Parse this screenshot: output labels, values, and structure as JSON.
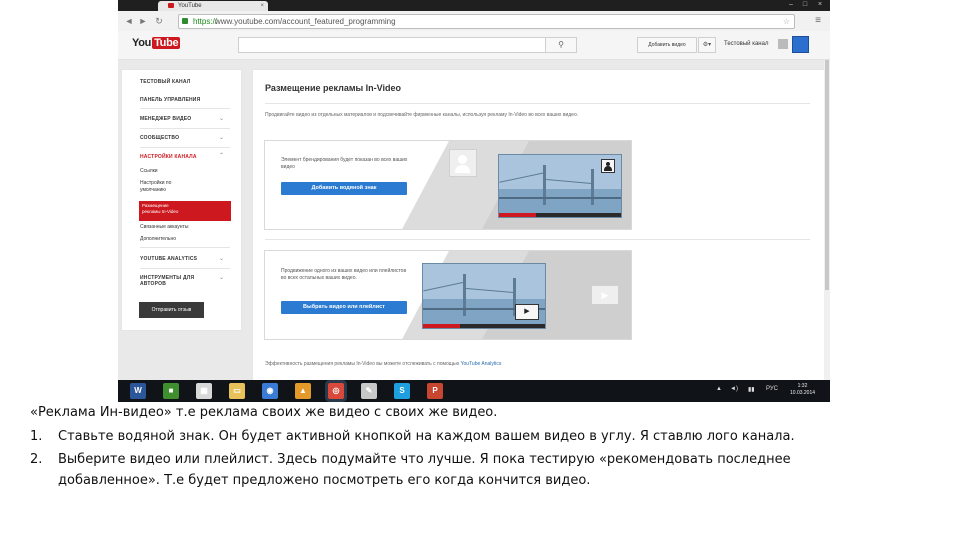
{
  "browser": {
    "tab_title": "YouTube",
    "tab_close": "×",
    "window_controls": [
      "–",
      "□",
      "×"
    ],
    "url_scheme": "https://",
    "url_rest": "www.youtube.com/account_featured_programming",
    "nav_icons": [
      "back-icon",
      "forward-icon",
      "reload-icon"
    ]
  },
  "youtube": {
    "logo_you": "You",
    "logo_tube": "Tube",
    "upload_label": "Добавить видео",
    "channel_name": "Тестовый канал"
  },
  "sidebar": {
    "channel": "ТЕСТОВЫЙ КАНАЛ",
    "dashboard": "ПАНЕЛЬ УПРАВЛЕНИЯ",
    "video_manager": "МЕНЕДЖЕР ВИДЕО",
    "community": "СООБЩЕСТВО",
    "channel_settings": "НАСТРОЙКИ КАНАЛА",
    "sub_items": [
      "Ссылки",
      "Настройки по",
      "умолчанию"
    ],
    "active_line1": "Размещение",
    "active_line2": "рекламы In-Video",
    "sub_items_2": [
      "Связанные аккаунты",
      "Дополнительно"
    ],
    "analytics": "YOUTUBE ANALYTICS",
    "tools_line1": "ИНСТРУМЕНТЫ ДЛЯ",
    "tools_line2": "АВТОРОВ",
    "feedback": "Отправить отзыв"
  },
  "main": {
    "title": "Размещение рекламы In-Video",
    "description": "Продвигайте видео из отдельных материалов и подсвечивайте фирменные каналы, используя рекламу In-Video во всех ваших видео.",
    "card1_text": "Элемент брендирования будет показан во всех ваших видео",
    "card1_button": "Добавить водяной знак",
    "card2_text": "Продвижение одного из ваших видео или плейлистов во всех остальных ваших видео.",
    "card2_button": "Выбрать видео или плейлист",
    "footer_text": "Эффективность размещения рекламы In-Video вы можете отслеживать с помощью",
    "footer_link": "YouTube Analytics"
  },
  "taskbar": {
    "apps": [
      {
        "name": "word-icon",
        "glyph": "W",
        "color": "#2b579a"
      },
      {
        "name": "app-green-icon",
        "glyph": "■",
        "color": "#3f8f2f"
      },
      {
        "name": "grid-app-icon",
        "glyph": "▦",
        "color": "#d8d8d8"
      },
      {
        "name": "folder-icon",
        "glyph": "▭",
        "color": "#e8c15a"
      },
      {
        "name": "globe-icon",
        "glyph": "◉",
        "color": "#3a7bd5"
      },
      {
        "name": "warning-icon",
        "glyph": "▲",
        "color": "#e39a2b"
      },
      {
        "name": "chrome-icon",
        "glyph": "◎",
        "color": "#d9483b"
      },
      {
        "name": "pen-tool-icon",
        "glyph": "✎",
        "color": "#c8c8c8"
      },
      {
        "name": "skype-icon",
        "glyph": "S",
        "color": "#1e9fe0"
      },
      {
        "name": "powerpoint-icon",
        "glyph": "P",
        "color": "#c8452f"
      }
    ],
    "tray_glyphs": [
      "▲",
      "◄)",
      "▮▮"
    ],
    "lang": "РУС",
    "time": "1:32",
    "date": "10.03.2014"
  },
  "caption": {
    "line1": "«Реклама Ин-видео» т.е реклама своих же видео с своих же видео.",
    "item1_num": "1.",
    "item1": "Ставьте водяной знак. Он будет активной кнопкой на каждом вашем видео в углу. Я ставлю лого канала.",
    "item2_num": "2.",
    "item2_a": "Выберите видео или плейлист. Здесь подумайте что лучше. Я пока тестирую «рекомендовать последнее",
    "item2_b": "добавленное». Т.е будет предложено посмотреть его когда кончится видео."
  }
}
